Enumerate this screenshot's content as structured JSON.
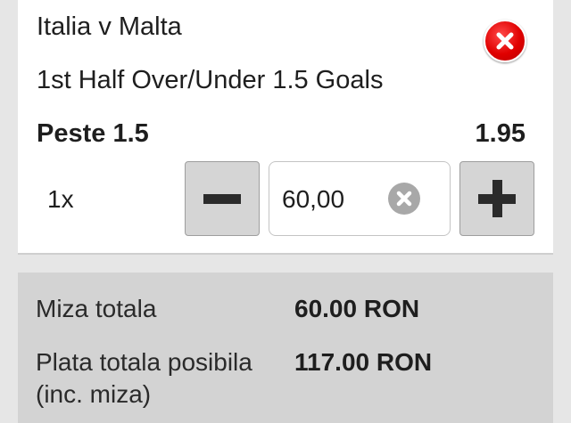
{
  "bet": {
    "event": "Italia v Malta",
    "market": "1st Half Over/Under 1.5 Goals",
    "selection": "Peste 1.5",
    "odds": "1.95",
    "multiplier": "1x",
    "stake": "60,00"
  },
  "summary": {
    "total_stake_label": "Miza totala",
    "total_stake_value": "60.00 RON",
    "potential_payout_label_line1": "Plata totala posibila",
    "potential_payout_label_line2": "(inc. miza)",
    "potential_payout_value": "117.00 RON"
  },
  "colors": {
    "close_red": "#e00000",
    "button_gray": "#d5d5d5",
    "summary_bg": "#d3d3d3",
    "page_bg": "#e6e6e6"
  },
  "icons": {
    "close": "close-x-icon",
    "clear": "clear-x-icon",
    "minus": "minus-icon",
    "plus": "plus-icon"
  }
}
